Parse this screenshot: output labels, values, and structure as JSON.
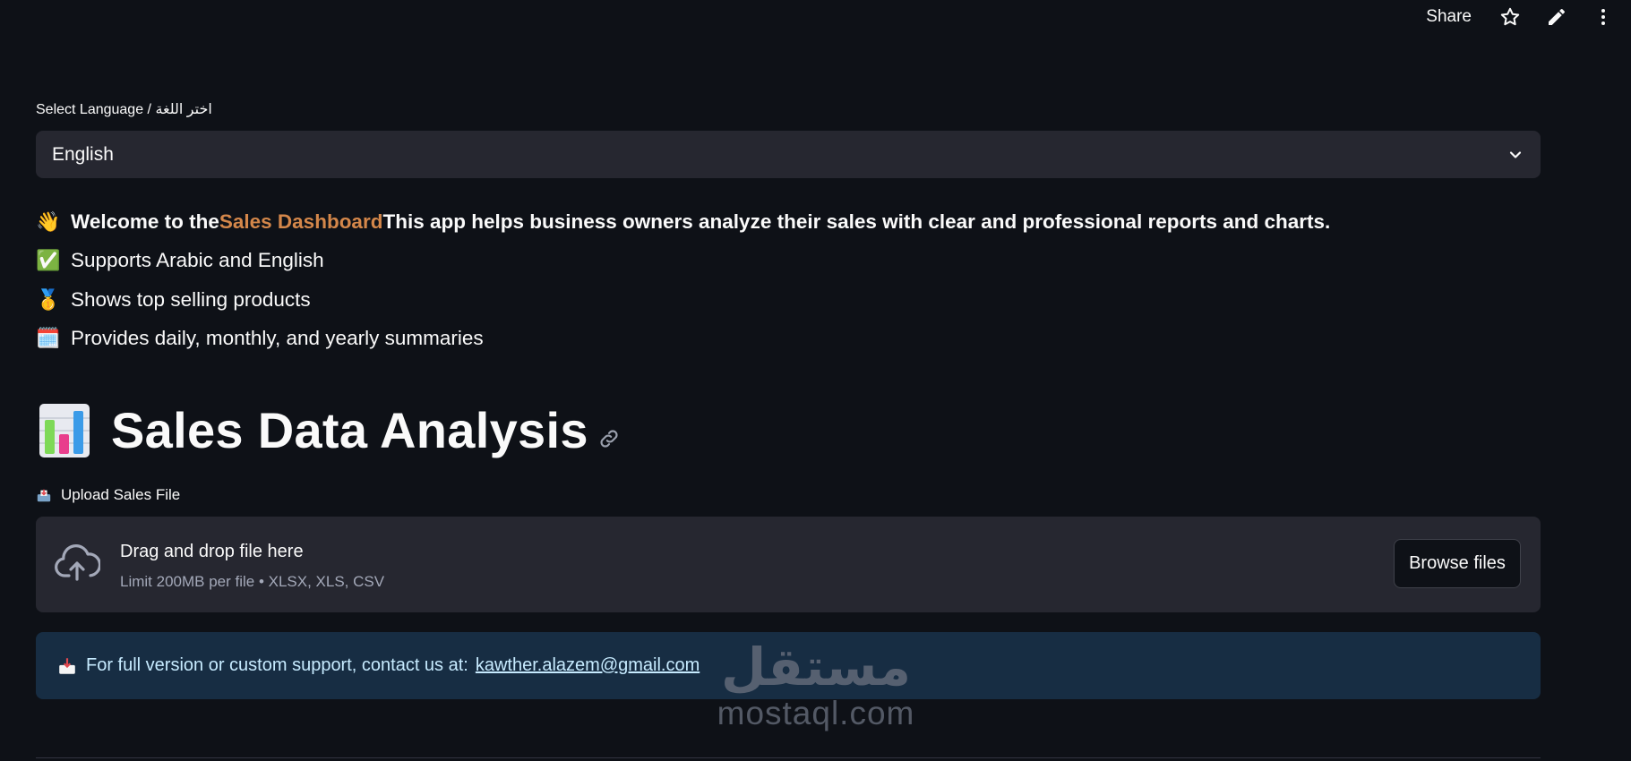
{
  "topbar": {
    "share_label": "Share",
    "icons": [
      "star-icon",
      "pencil-icon",
      "kebab-menu-icon"
    ]
  },
  "language": {
    "label": "Select Language / اختر اللغة",
    "selected": "English"
  },
  "intro": {
    "welcome_prefix": "Welcome to the ",
    "welcome_highlight": "Sales Dashboard",
    "welcome_suffix": " This app helps business owners analyze their sales with clear and professional reports and charts.",
    "features": [
      {
        "emoji": "✅",
        "text": "Supports Arabic and English"
      },
      {
        "emoji": "🥇",
        "text": "Shows top selling products"
      },
      {
        "emoji": "🗓️",
        "text": "Provides daily, monthly, and yearly summaries"
      }
    ],
    "welcome_emoji": "👋"
  },
  "title": {
    "text": "Sales Data Analysis"
  },
  "upload": {
    "label": "Upload Sales File",
    "drag_text": "Drag and drop file here",
    "limit_text": "Limit 200MB per file • XLSX, XLS, CSV",
    "browse_label": "Browse files"
  },
  "contact": {
    "text": "For full version or custom support, contact us at:",
    "email": "kawther.alazem@gmail.com"
  },
  "watermark": {
    "arabic": "مستقل",
    "latin": "mostaql.com"
  },
  "colors": {
    "background": "#0e1117",
    "panel": "#262730",
    "info_bg": "#172d43",
    "highlight": "#d4874a"
  }
}
